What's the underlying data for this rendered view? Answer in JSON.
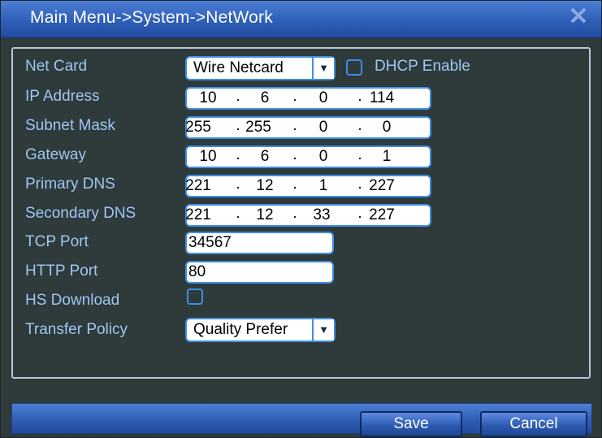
{
  "window": {
    "title": "Main Menu->System->NetWork",
    "close_icon": "close-icon",
    "colors": {
      "titlebar": "#2f5fb8",
      "panel": "#2f3a3b",
      "label": "#9fc6f2",
      "field_border": "#3d8ee6"
    }
  },
  "net_card": {
    "label": "Net Card",
    "selected": "Wire Netcard",
    "arrow_icon": "dropdown-arrow-icon"
  },
  "dhcp": {
    "label": "DHCP Enable",
    "checked": false
  },
  "ip_address": {
    "label": "IP Address",
    "octets": [
      "10",
      "6",
      "0",
      "114"
    ]
  },
  "subnet_mask": {
    "label": "Subnet Mask",
    "octets": [
      "255",
      "255",
      "0",
      "0"
    ]
  },
  "gateway": {
    "label": "Gateway",
    "octets": [
      "10",
      "6",
      "0",
      "1"
    ]
  },
  "primary_dns": {
    "label": "Primary DNS",
    "octets": [
      "221",
      "12",
      "1",
      "227"
    ]
  },
  "secondary_dns": {
    "label": "Secondary DNS",
    "octets": [
      "221",
      "12",
      "33",
      "227"
    ]
  },
  "tcp_port": {
    "label": "TCP Port",
    "value": "34567"
  },
  "http_port": {
    "label": "HTTP Port",
    "value": "80"
  },
  "hs_download": {
    "label": "HS Download",
    "checked": false
  },
  "transfer_policy": {
    "label": "Transfer Policy",
    "selected": "Quality Prefer",
    "arrow_icon": "dropdown-arrow-icon"
  },
  "buttons": {
    "save": "Save",
    "cancel": "Cancel"
  }
}
